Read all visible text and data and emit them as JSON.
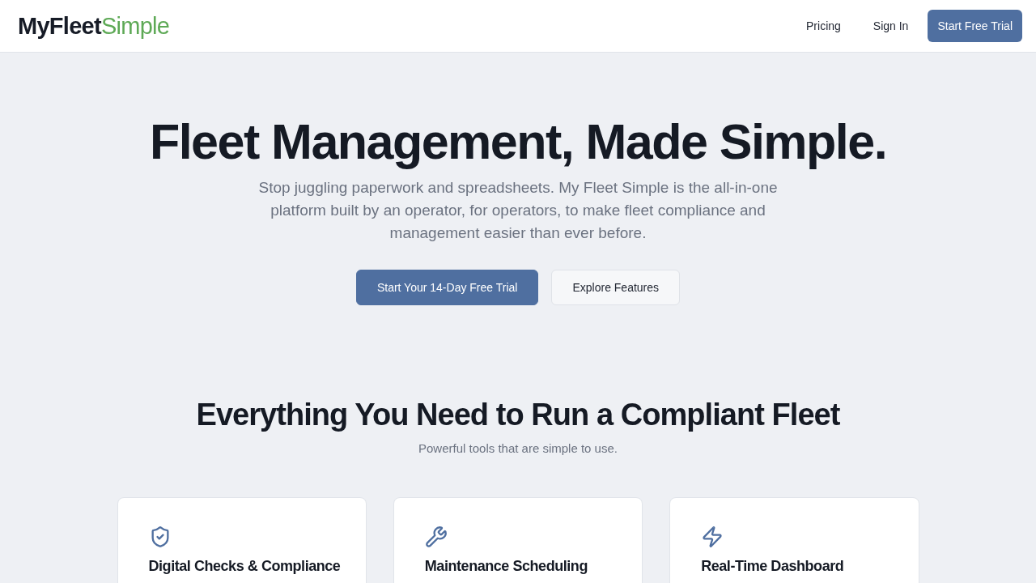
{
  "header": {
    "logo": {
      "primary": "MyFleet",
      "accent": "Simple"
    },
    "nav_links": [
      "Pricing",
      "Sign In"
    ],
    "cta_button": "Start Free Trial"
  },
  "hero": {
    "title": "Fleet Management, Made Simple.",
    "subtitle": "Stop juggling paperwork and spreadsheets. My Fleet Simple is the all-in-one platform built by an operator, for operators, to make fleet compliance and management easier than ever before.",
    "buttons": [
      {
        "label": "Start Your 14-Day Free Trial",
        "kind": "primary"
      },
      {
        "label": "Explore Features",
        "kind": "secondary"
      }
    ]
  },
  "features": {
    "title": "Everything You Need to Run a Compliant Fleet",
    "subtitle": "Powerful tools that are simple to use.",
    "cards": [
      {
        "title": "Digital Checks & Compliance"
      },
      {
        "title": "Maintenance Scheduling"
      },
      {
        "title": "Real-Time Dashboard"
      }
    ]
  }
}
